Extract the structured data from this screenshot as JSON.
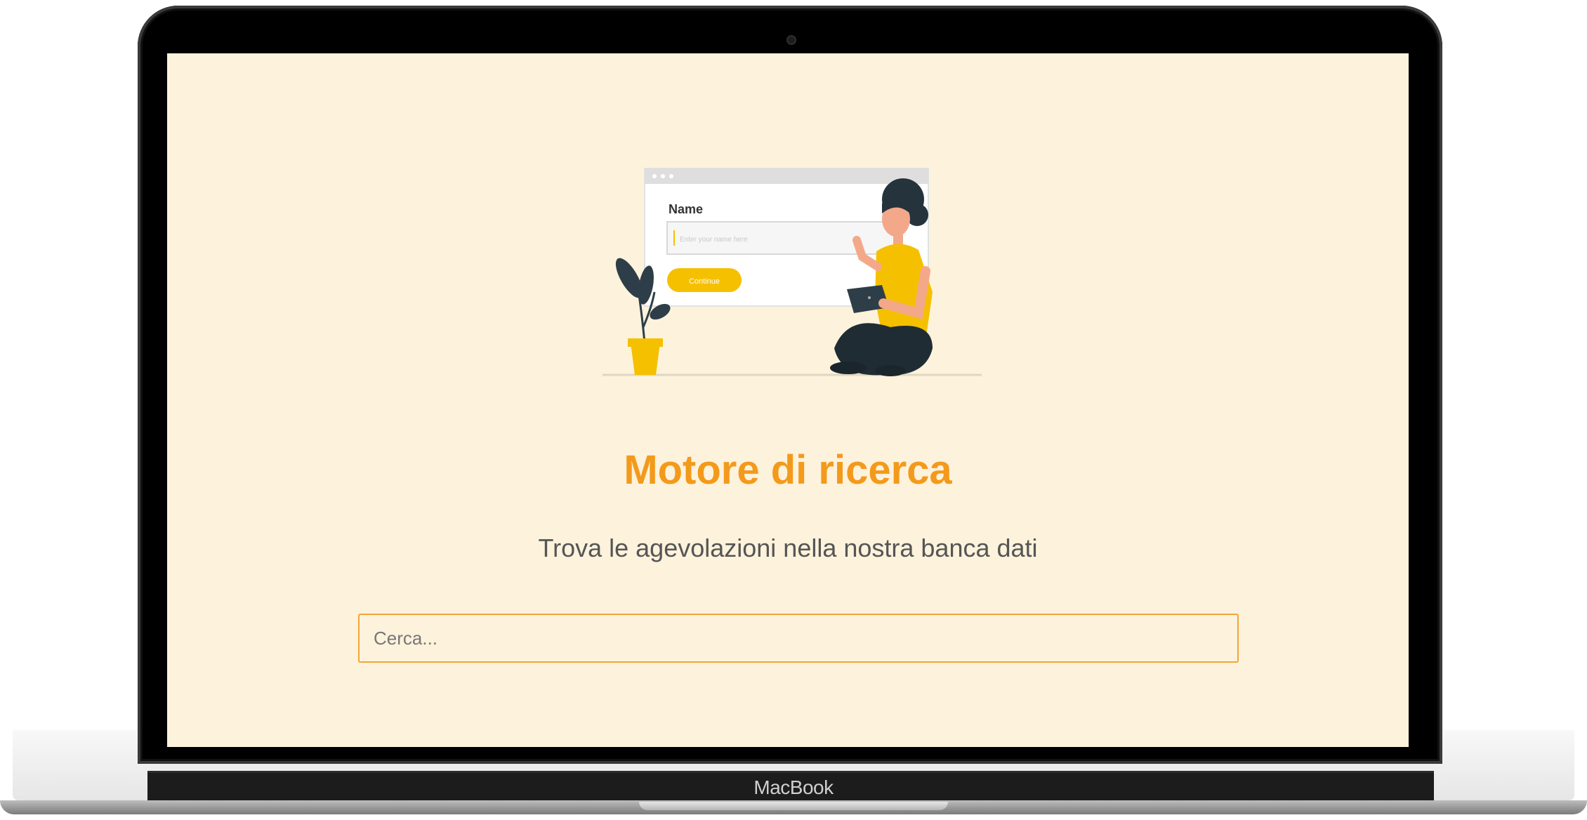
{
  "device": {
    "brand": "MacBook"
  },
  "illustration": {
    "form_label": "Name",
    "input_placeholder": "Enter your name here",
    "button_label": "Continue"
  },
  "page": {
    "title": "Motore di ricerca",
    "subtitle": "Trova le agevolazioni nella nostra banca dati"
  },
  "search": {
    "placeholder": "Cerca..."
  },
  "colors": {
    "screen_bg": "#fdf2dc",
    "accent": "#f39a1b",
    "illustration_yellow": "#f5c000"
  }
}
